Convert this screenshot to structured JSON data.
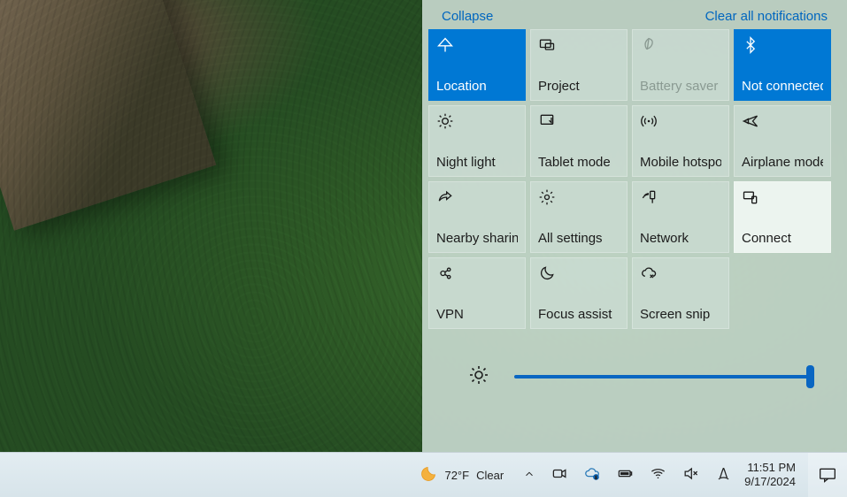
{
  "action_center": {
    "collapse_label": "Collapse",
    "clear_label": "Clear all notifications",
    "tiles": [
      {
        "label": "Location",
        "icon": "location-icon",
        "state": "active"
      },
      {
        "label": "Project",
        "icon": "project-icon",
        "state": "off"
      },
      {
        "label": "Battery saver",
        "icon": "leaf-icon",
        "state": "disabled"
      },
      {
        "label": "Not connected",
        "icon": "bluetooth-icon",
        "state": "active"
      },
      {
        "label": "Night light",
        "icon": "sun-icon",
        "state": "off"
      },
      {
        "label": "Tablet mode",
        "icon": "tablet-icon",
        "state": "off"
      },
      {
        "label": "Mobile hotspot",
        "icon": "hotspot-icon",
        "state": "off"
      },
      {
        "label": "Airplane mode",
        "icon": "airplane-icon",
        "state": "off"
      },
      {
        "label": "Nearby sharing",
        "icon": "share-icon",
        "state": "off"
      },
      {
        "label": "All settings",
        "icon": "gear-icon",
        "state": "off"
      },
      {
        "label": "Network",
        "icon": "network-icon",
        "state": "off"
      },
      {
        "label": "Connect",
        "icon": "connect-icon",
        "state": "hover"
      },
      {
        "label": "VPN",
        "icon": "vpn-icon",
        "state": "off"
      },
      {
        "label": "Focus assist",
        "icon": "moon-icon",
        "state": "off"
      },
      {
        "label": "Screen snip",
        "icon": "snip-icon",
        "state": "off"
      }
    ],
    "brightness_percent": 100
  },
  "taskbar": {
    "weather_temp": "72°F",
    "weather_cond": "Clear",
    "time": "11:51 PM",
    "date": "9/17/2024"
  },
  "colors": {
    "accent": "#0078d4",
    "link": "#0066bf"
  }
}
